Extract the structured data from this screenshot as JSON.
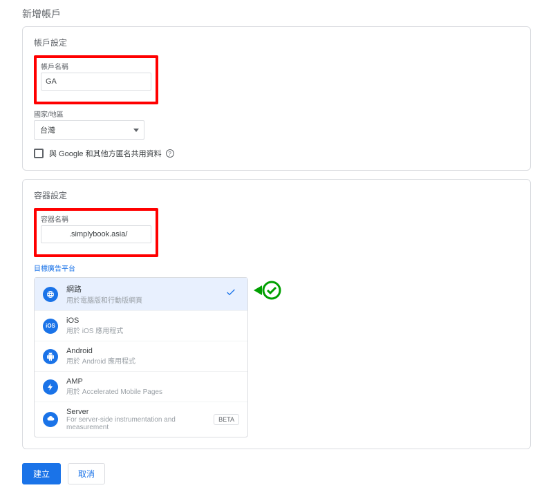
{
  "page": {
    "title": "新增帳戶"
  },
  "account": {
    "section_title": "帳戶設定",
    "name_label": "帳戶名稱",
    "name_value": "GA",
    "country_label": "國家/地區",
    "country_value": "台灣",
    "share_checkbox_label": "與 Google 和其他方匿名共用資料"
  },
  "container": {
    "section_title": "容器設定",
    "name_label": "容器名稱",
    "name_value": ".simplybook.asia/",
    "platform_link": "目標廣告平台",
    "platforms": [
      {
        "name": "網路",
        "desc": "用於電腦版和行動版網頁",
        "selected": true
      },
      {
        "name": "iOS",
        "desc": "用於 iOS 應用程式",
        "selected": false
      },
      {
        "name": "Android",
        "desc": "用於 Android 應用程式",
        "selected": false
      },
      {
        "name": "AMP",
        "desc": "用於 Accelerated Mobile Pages",
        "selected": false
      },
      {
        "name": "Server",
        "desc": "For server-side instrumentation and measurement",
        "selected": false,
        "beta": true
      }
    ],
    "beta_label": "BETA"
  },
  "actions": {
    "create": "建立",
    "cancel": "取消"
  }
}
